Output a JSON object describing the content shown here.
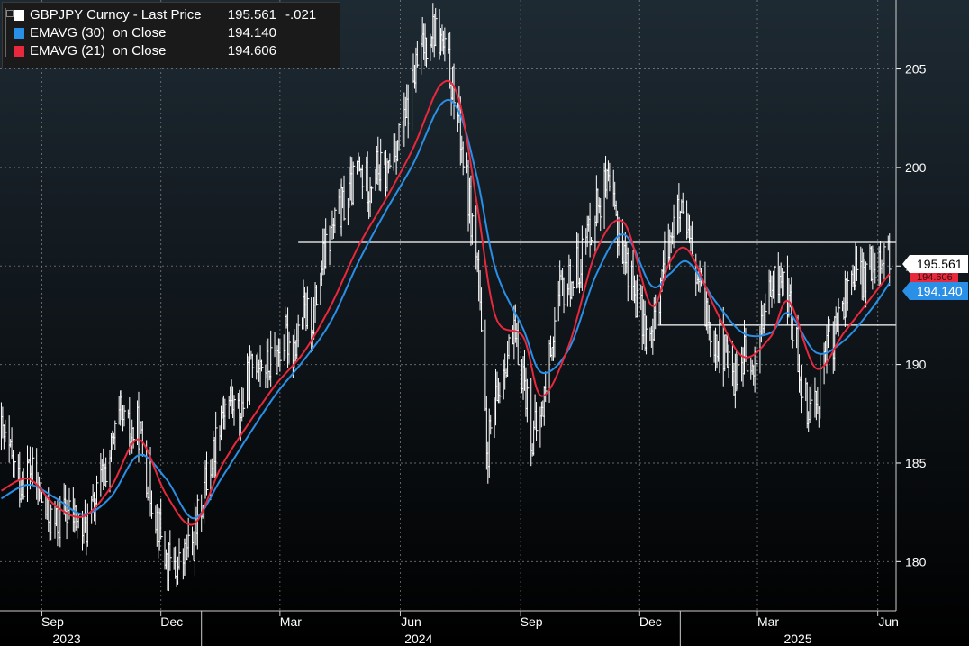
{
  "legend": {
    "security": "GBPJPY Curncy - Last Price",
    "last": "195.561",
    "change": "-.021",
    "ema30_label": "EMAVG (30)  on Close",
    "ema30_value": "194.140",
    "ema21_label": "EMAVG (21)  on Close",
    "ema21_value": "194.606"
  },
  "tags": {
    "last": "195.561",
    "ema21": "194.606",
    "ema30": "194.140"
  },
  "colors": {
    "background_top": "#1e2a33",
    "background_bottom": "#000000",
    "price": "#ffffff",
    "ema30": "#2a8fe6",
    "ema21": "#e8283c",
    "grid": "#8a8a8a",
    "axis_text": "#ffffff"
  },
  "chart_data": {
    "type": "line",
    "title": "",
    "xlabel": "",
    "ylabel": "",
    "ylim": [
      177.5,
      208.5
    ],
    "y_ticks": [
      180,
      185,
      190,
      195,
      200,
      205
    ],
    "grid": "dotted horizontal and vertical",
    "month_ticks": [
      {
        "label": "Sep",
        "date": "2023-09-01"
      },
      {
        "label": "Dec",
        "date": "2023-12-01"
      },
      {
        "label": "Mar",
        "date": "2024-03-01"
      },
      {
        "label": "Jun",
        "date": "2024-06-01"
      },
      {
        "label": "Sep",
        "date": "2024-09-01"
      },
      {
        "label": "Dec",
        "date": "2024-12-01"
      },
      {
        "label": "Mar",
        "date": "2025-03-01"
      },
      {
        "label": "Jun",
        "date": "2025-06-01"
      }
    ],
    "year_labels": [
      {
        "label": "2023",
        "center_date": "2023-09-20"
      },
      {
        "label": "2024",
        "center_date": "2024-06-15"
      },
      {
        "label": "2025",
        "center_date": "2025-04-01"
      }
    ],
    "year_separators": [
      "2024-01-01",
      "2025-01-01"
    ],
    "x_start": "2023-07-31",
    "x_end": "2025-06-15",
    "horizontal_lines": [
      {
        "y": 196.2,
        "from": "2024-03-15",
        "to": "2025-06-15"
      },
      {
        "y": 192.0,
        "from": "2024-12-15",
        "to": "2025-06-15"
      }
    ],
    "series": [
      {
        "name": "GBPJPY Curncy - Last Price",
        "style": "hlc_bars",
        "points": [
          [
            "2023-08-01",
            186.5
          ],
          [
            "2023-08-08",
            185.2
          ],
          [
            "2023-08-15",
            184.0
          ],
          [
            "2023-08-22",
            184.8
          ],
          [
            "2023-08-29",
            183.6
          ],
          [
            "2023-09-05",
            182.3
          ],
          [
            "2023-09-12",
            181.8
          ],
          [
            "2023-09-19",
            182.6
          ],
          [
            "2023-09-26",
            182.2
          ],
          [
            "2023-10-03",
            181.5
          ],
          [
            "2023-10-10",
            182.6
          ],
          [
            "2023-10-17",
            184.2
          ],
          [
            "2023-10-24",
            185.6
          ],
          [
            "2023-10-31",
            187.3
          ],
          [
            "2023-11-07",
            186.4
          ],
          [
            "2023-11-14",
            186.8
          ],
          [
            "2023-11-21",
            184.2
          ],
          [
            "2023-11-28",
            182.3
          ],
          [
            "2023-12-05",
            180.0
          ],
          [
            "2023-12-12",
            179.5
          ],
          [
            "2023-12-19",
            180.2
          ],
          [
            "2023-12-26",
            181.0
          ],
          [
            "2024-01-02",
            183.5
          ],
          [
            "2024-01-09",
            185.2
          ],
          [
            "2024-01-16",
            187.8
          ],
          [
            "2024-01-23",
            188.2
          ],
          [
            "2024-01-30",
            187.4
          ],
          [
            "2024-02-06",
            189.3
          ],
          [
            "2024-02-13",
            190.6
          ],
          [
            "2024-02-20",
            189.8
          ],
          [
            "2024-02-27",
            190.4
          ],
          [
            "2024-03-05",
            191.4
          ],
          [
            "2024-03-12",
            191.0
          ],
          [
            "2024-03-19",
            192.5
          ],
          [
            "2024-03-26",
            192.3
          ],
          [
            "2024-04-02",
            195.0
          ],
          [
            "2024-04-09",
            196.5
          ],
          [
            "2024-04-16",
            197.8
          ],
          [
            "2024-04-23",
            198.6
          ],
          [
            "2024-04-30",
            199.8
          ],
          [
            "2024-05-07",
            199.2
          ],
          [
            "2024-05-14",
            200.0
          ],
          [
            "2024-05-21",
            199.6
          ],
          [
            "2024-05-28",
            201.2
          ],
          [
            "2024-06-04",
            202.0
          ],
          [
            "2024-06-11",
            204.5
          ],
          [
            "2024-06-18",
            206.0
          ],
          [
            "2024-06-25",
            207.2
          ],
          [
            "2024-07-02",
            206.4
          ],
          [
            "2024-07-09",
            204.8
          ],
          [
            "2024-07-16",
            202.2
          ],
          [
            "2024-07-23",
            198.5
          ],
          [
            "2024-07-30",
            195.2
          ],
          [
            "2024-08-06",
            185.5
          ],
          [
            "2024-08-13",
            187.8
          ],
          [
            "2024-08-20",
            190.4
          ],
          [
            "2024-08-27",
            191.2
          ],
          [
            "2024-09-03",
            189.6
          ],
          [
            "2024-09-10",
            186.2
          ],
          [
            "2024-09-17",
            187.4
          ],
          [
            "2024-09-24",
            191.0
          ],
          [
            "2024-10-01",
            193.5
          ],
          [
            "2024-10-08",
            194.2
          ],
          [
            "2024-10-15",
            195.0
          ],
          [
            "2024-10-22",
            196.6
          ],
          [
            "2024-10-29",
            198.2
          ],
          [
            "2024-11-05",
            199.0
          ],
          [
            "2024-11-12",
            197.6
          ],
          [
            "2024-11-19",
            195.6
          ],
          [
            "2024-11-26",
            194.0
          ],
          [
            "2024-12-03",
            192.2
          ],
          [
            "2024-12-10",
            191.0
          ],
          [
            "2024-12-17",
            194.2
          ],
          [
            "2024-12-24",
            196.8
          ],
          [
            "2024-12-31",
            197.6
          ],
          [
            "2025-01-07",
            196.2
          ],
          [
            "2025-01-14",
            194.2
          ],
          [
            "2025-01-21",
            192.6
          ],
          [
            "2025-01-28",
            191.4
          ],
          [
            "2025-02-04",
            190.5
          ],
          [
            "2025-02-11",
            189.4
          ],
          [
            "2025-02-18",
            190.6
          ],
          [
            "2025-02-25",
            189.2
          ],
          [
            "2025-03-04",
            192.2
          ],
          [
            "2025-03-11",
            193.5
          ],
          [
            "2025-03-18",
            194.6
          ],
          [
            "2025-03-25",
            193.2
          ],
          [
            "2025-04-01",
            190.4
          ],
          [
            "2025-04-08",
            188.0
          ],
          [
            "2025-04-15",
            188.2
          ],
          [
            "2025-04-22",
            190.4
          ],
          [
            "2025-04-29",
            191.6
          ],
          [
            "2025-05-06",
            193.2
          ],
          [
            "2025-05-13",
            194.8
          ],
          [
            "2025-05-20",
            194.2
          ],
          [
            "2025-05-27",
            195.2
          ],
          [
            "2025-06-03",
            195.8
          ],
          [
            "2025-06-10",
            195.5
          ]
        ]
      },
      {
        "name": "EMAVG (30)  on Close",
        "style": "line",
        "points": [
          [
            "2023-08-01",
            183.2
          ],
          [
            "2023-08-22",
            183.9
          ],
          [
            "2023-09-12",
            183.2
          ],
          [
            "2023-10-03",
            182.4
          ],
          [
            "2023-10-24",
            183.3
          ],
          [
            "2023-11-14",
            185.4
          ],
          [
            "2023-12-05",
            184.2
          ],
          [
            "2023-12-26",
            182.2
          ],
          [
            "2024-01-16",
            184.2
          ],
          [
            "2024-02-06",
            186.4
          ],
          [
            "2024-02-27",
            188.5
          ],
          [
            "2024-03-19",
            190.2
          ],
          [
            "2024-04-09",
            192.2
          ],
          [
            "2024-04-30",
            195.2
          ],
          [
            "2024-05-21",
            197.8
          ],
          [
            "2024-06-11",
            200.2
          ],
          [
            "2024-07-02",
            203.2
          ],
          [
            "2024-07-16",
            202.8
          ],
          [
            "2024-07-30",
            199.4
          ],
          [
            "2024-08-13",
            194.8
          ],
          [
            "2024-09-03",
            191.8
          ],
          [
            "2024-09-17",
            189.6
          ],
          [
            "2024-10-08",
            190.8
          ],
          [
            "2024-10-29",
            194.6
          ],
          [
            "2024-11-19",
            196.6
          ],
          [
            "2024-12-10",
            194.0
          ],
          [
            "2024-12-24",
            194.6
          ],
          [
            "2025-01-07",
            195.2
          ],
          [
            "2025-01-28",
            193.2
          ],
          [
            "2025-02-18",
            191.6
          ],
          [
            "2025-03-11",
            191.6
          ],
          [
            "2025-03-25",
            192.6
          ],
          [
            "2025-04-15",
            190.6
          ],
          [
            "2025-05-06",
            191.2
          ],
          [
            "2025-05-27",
            192.8
          ],
          [
            "2025-06-10",
            194.14
          ]
        ]
      },
      {
        "name": "EMAVG (21)  on Close",
        "style": "line",
        "points": [
          [
            "2023-08-01",
            183.6
          ],
          [
            "2023-08-22",
            184.2
          ],
          [
            "2023-09-12",
            182.8
          ],
          [
            "2023-10-03",
            182.3
          ],
          [
            "2023-10-24",
            183.8
          ],
          [
            "2023-11-14",
            186.2
          ],
          [
            "2023-12-05",
            183.4
          ],
          [
            "2023-12-26",
            181.9
          ],
          [
            "2024-01-16",
            184.8
          ],
          [
            "2024-02-06",
            187.0
          ],
          [
            "2024-02-27",
            189.0
          ],
          [
            "2024-03-19",
            190.6
          ],
          [
            "2024-04-09",
            193.0
          ],
          [
            "2024-04-30",
            196.0
          ],
          [
            "2024-05-21",
            198.4
          ],
          [
            "2024-06-11",
            201.0
          ],
          [
            "2024-07-02",
            204.2
          ],
          [
            "2024-07-16",
            203.4
          ],
          [
            "2024-07-30",
            198.0
          ],
          [
            "2024-08-13",
            192.4
          ],
          [
            "2024-09-03",
            191.4
          ],
          [
            "2024-09-17",
            188.4
          ],
          [
            "2024-10-08",
            191.0
          ],
          [
            "2024-10-29",
            195.8
          ],
          [
            "2024-11-19",
            197.2
          ],
          [
            "2024-12-10",
            193.0
          ],
          [
            "2024-12-24",
            195.2
          ],
          [
            "2025-01-07",
            195.8
          ],
          [
            "2025-01-28",
            192.8
          ],
          [
            "2025-02-18",
            190.4
          ],
          [
            "2025-03-11",
            191.4
          ],
          [
            "2025-03-25",
            193.2
          ],
          [
            "2025-04-15",
            189.8
          ],
          [
            "2025-05-06",
            191.6
          ],
          [
            "2025-05-27",
            193.4
          ],
          [
            "2025-06-10",
            194.606
          ]
        ]
      }
    ]
  }
}
